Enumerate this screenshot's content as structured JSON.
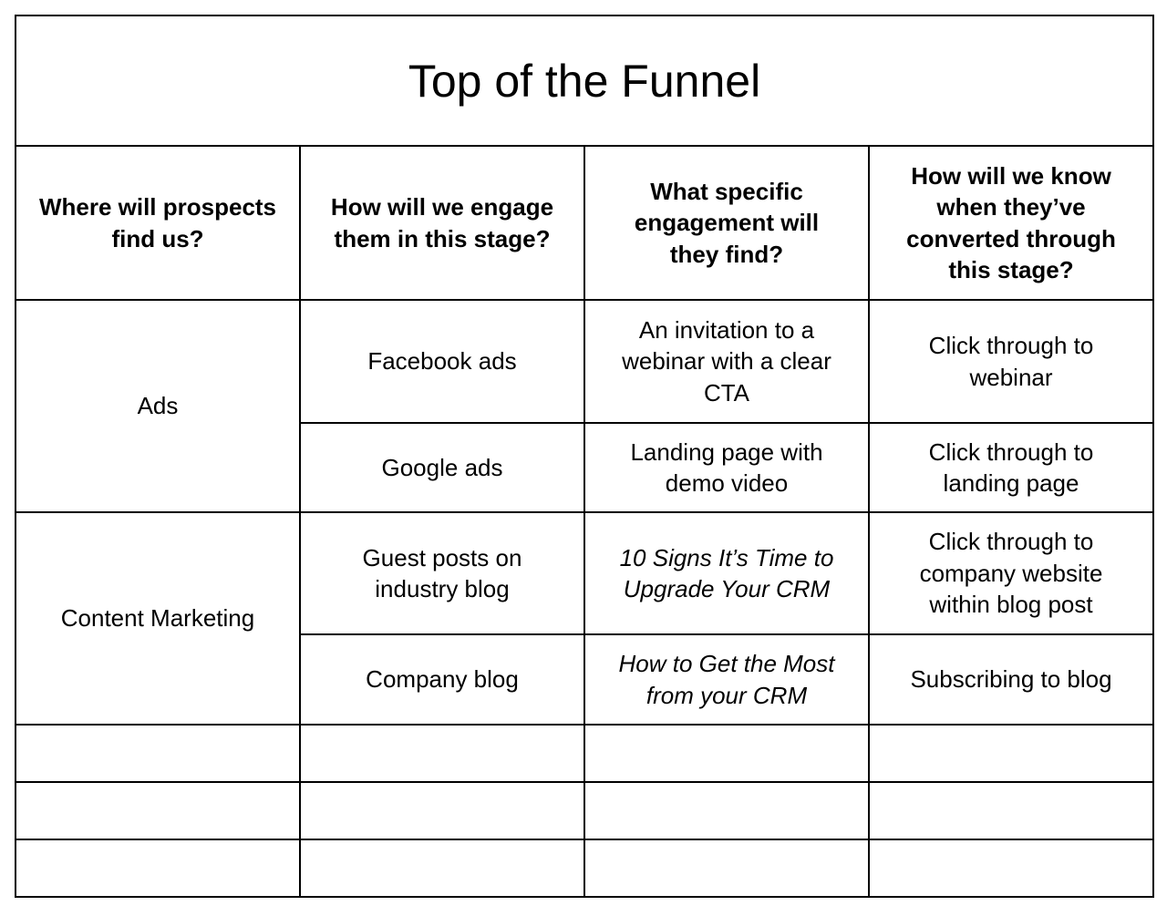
{
  "title": "Top of the Funnel",
  "headers": [
    "Where will prospects\nfind us?",
    "How will we engage\nthem in this stage?",
    "What specific\nengagement will\nthey find?",
    "How will we know\nwhen they’ve\nconverted through\nthis stage?"
  ],
  "groups": [
    {
      "channel": "Ads",
      "rows": [
        {
          "engage": "Facebook ads",
          "specific": "An invitation to a\nwebinar with a clear\nCTA",
          "converted": "Click through to\nwebinar"
        },
        {
          "engage": "Google ads",
          "specific": "Landing page with\ndemo video",
          "converted": "Click through to\nlanding page"
        }
      ]
    },
    {
      "channel": "Content Marketing",
      "rows": [
        {
          "engage": "Guest posts on\nindustry blog",
          "specific": "10 Signs It’s Time to\nUpgrade Your CRM",
          "converted": "Click through to\ncompany website\nwithin blog post"
        },
        {
          "engage": "Company blog",
          "specific": "How to Get the Most\nfrom your CRM",
          "converted": "Subscribing to blog"
        }
      ]
    }
  ]
}
